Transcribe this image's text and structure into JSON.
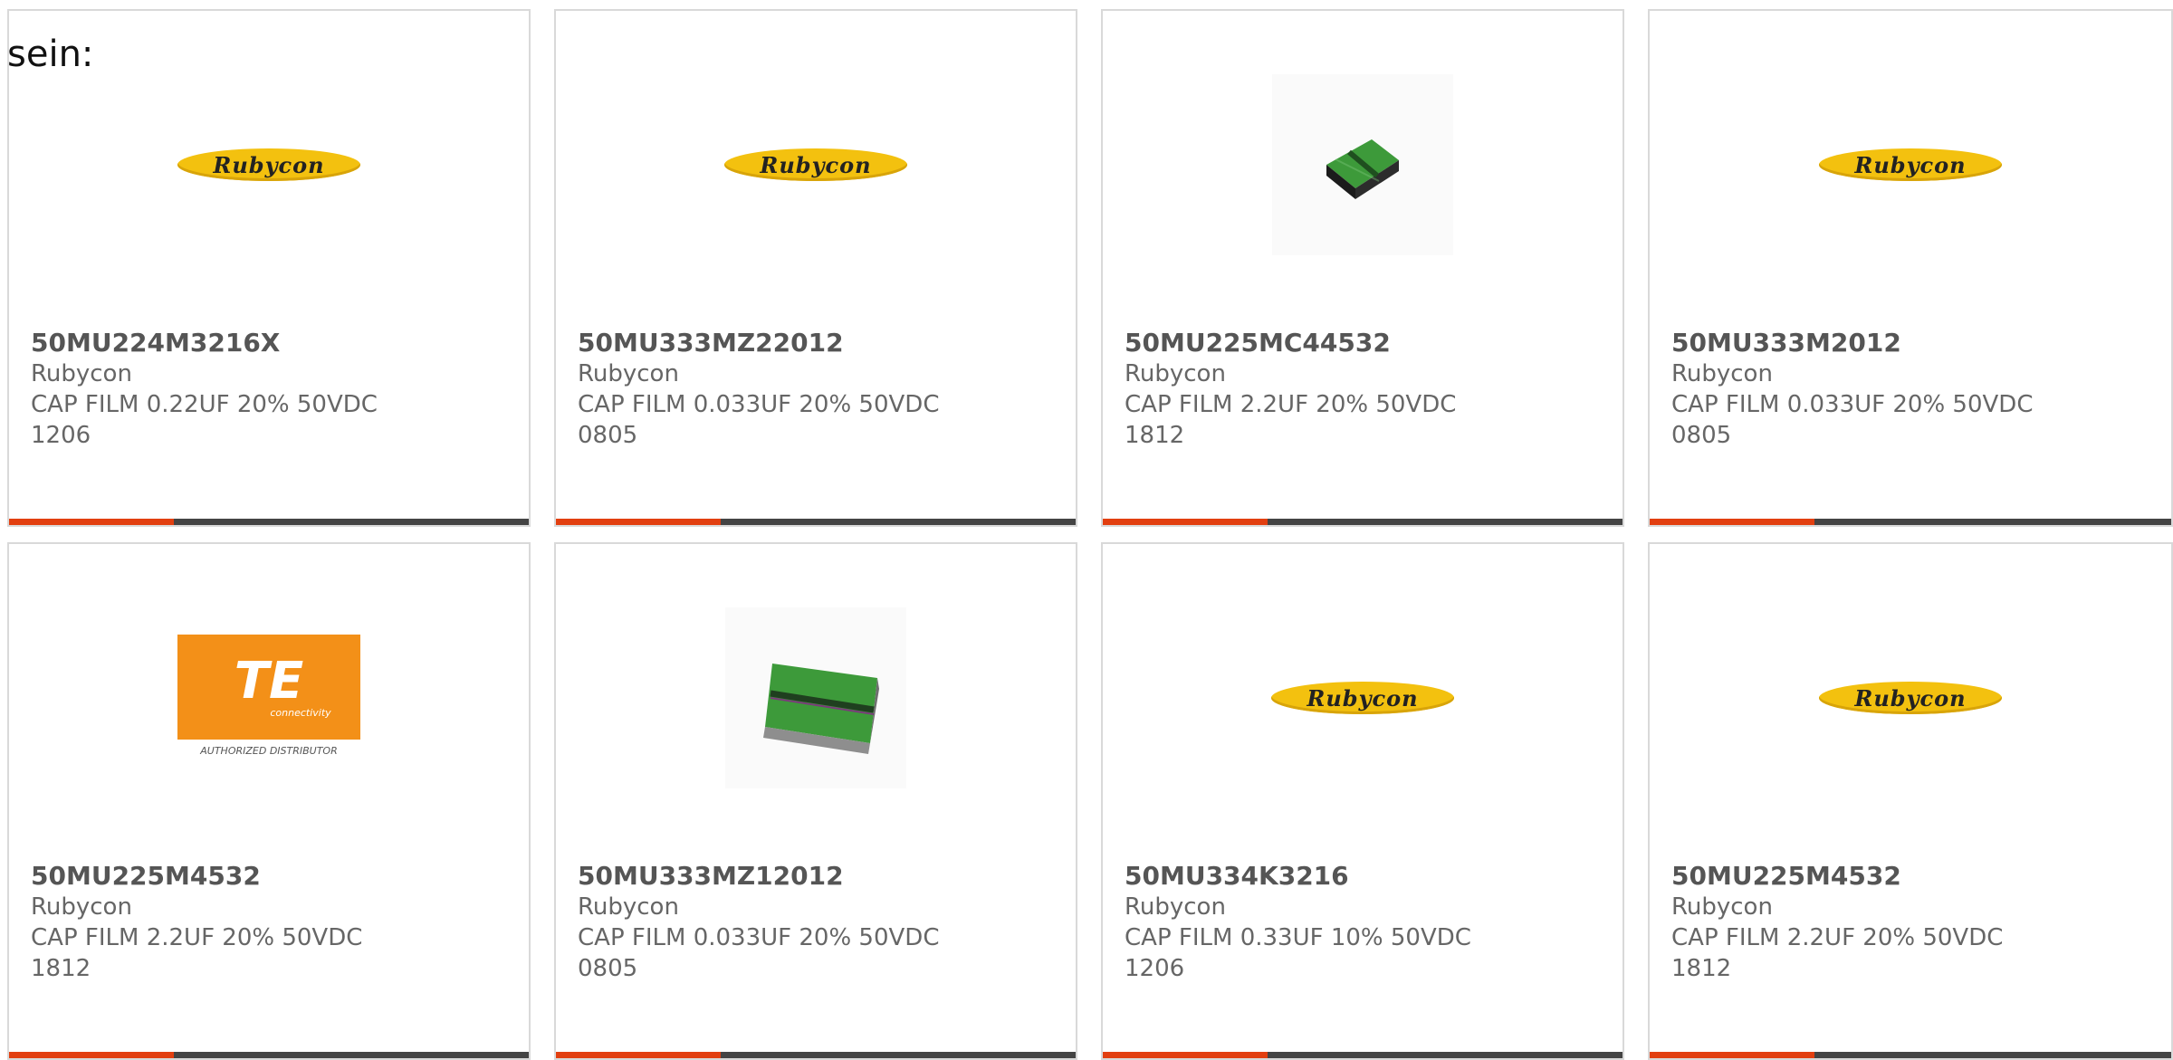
{
  "intro_text": "sein:",
  "products": [
    {
      "part_number": "50MU224M3216X",
      "manufacturer": "Rubycon",
      "description": "CAP FILM 0.22UF 20% 50VDC",
      "package": "1206",
      "image": "rubycon-logo",
      "logo_text": "Rubycon"
    },
    {
      "part_number": "50MU333MZ22012",
      "manufacturer": "Rubycon",
      "description": "CAP FILM 0.033UF 20% 50VDC",
      "package": "0805",
      "image": "rubycon-logo",
      "logo_text": "Rubycon"
    },
    {
      "part_number": "50MU225MC44532",
      "manufacturer": "Rubycon",
      "description": "CAP FILM 2.2UF 20% 50VDC",
      "package": "1812",
      "image": "film-capacitor-chip-photo"
    },
    {
      "part_number": "50MU333M2012",
      "manufacturer": "Rubycon",
      "description": "CAP FILM 0.033UF 20% 50VDC",
      "package": "0805",
      "image": "rubycon-logo",
      "logo_text": "Rubycon"
    },
    {
      "part_number": "50MU225M4532",
      "manufacturer": "Rubycon",
      "description": "CAP FILM 2.2UF 20% 50VDC",
      "package": "1812",
      "image": "te-connectivity-logo",
      "logo_text": "TE",
      "logo_subtext": "connectivity",
      "logo_caption": "AUTHORIZED DISTRIBUTOR"
    },
    {
      "part_number": "50MU333MZ12012",
      "manufacturer": "Rubycon",
      "description": "CAP FILM 0.033UF 20% 50VDC",
      "package": "0805",
      "image": "film-capacitor-chip-photo"
    },
    {
      "part_number": "50MU334K3216",
      "manufacturer": "Rubycon",
      "description": "CAP FILM 0.33UF 10% 50VDC",
      "package": "1206",
      "image": "rubycon-logo",
      "logo_text": "Rubycon"
    },
    {
      "part_number": "50MU225M4532",
      "manufacturer": "Rubycon",
      "description": "CAP FILM 2.2UF 20% 50VDC",
      "package": "1812",
      "image": "rubycon-logo",
      "logo_text": "Rubycon"
    }
  ],
  "colors": {
    "accent": "#e23f10",
    "bar": "#444444",
    "border": "#d9d9d9",
    "text": "#666666",
    "rubycon_yellow": "#f3c10f",
    "te_orange": "#f39018",
    "chip_green": "#3d9a3a"
  }
}
